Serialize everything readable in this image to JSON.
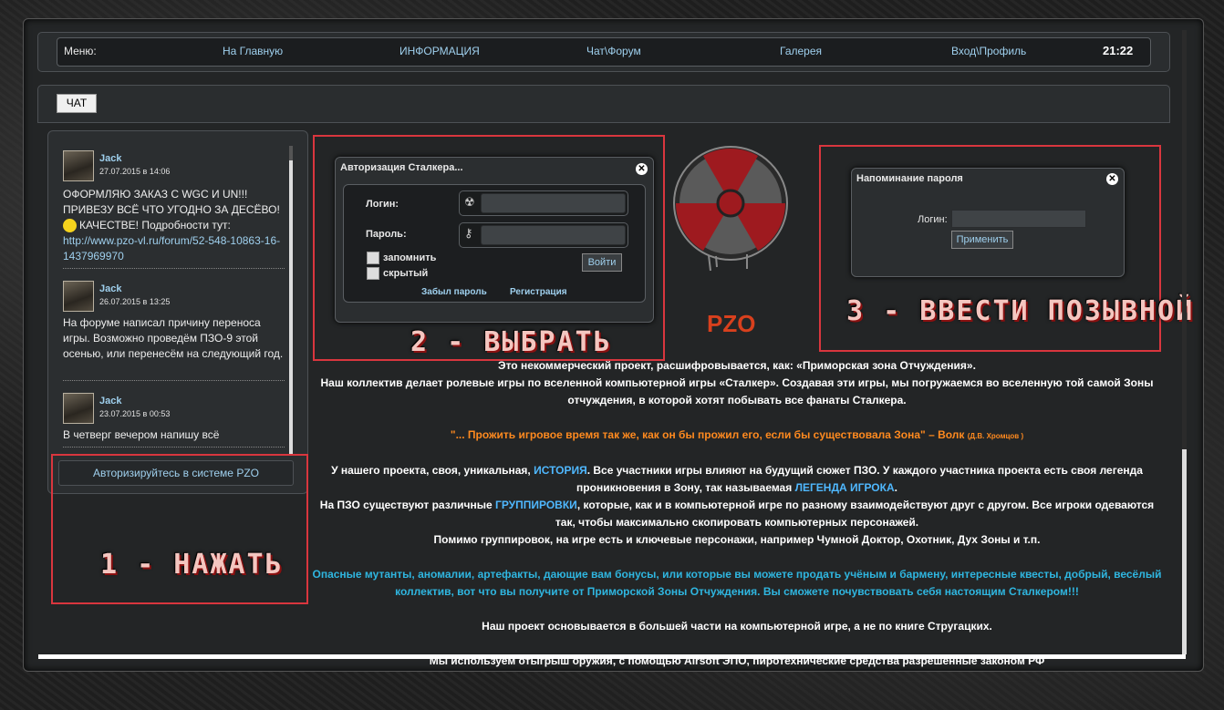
{
  "nav": {
    "menu_label": "Меню:",
    "items": [
      "На Главную",
      "ИНФОРМАЦИЯ",
      "Чат\\Форум",
      "Галерея",
      "Вход\\Профиль"
    ],
    "time": "21:22"
  },
  "chat": {
    "tab_label": "ЧАТ",
    "messages": [
      {
        "user": "Jack",
        "date": "27.07.2015 в 14:06",
        "text1": "ОФОРМЛЯЮ ЗАКАЗ С WGC И UN!!! ПРИВЕЗУ ВСЁ ЧТО УГОДНО ЗА ДЕСЁВО!",
        "text2": "КАЧЕСТВЕ! Подробности тут:",
        "link": "http://www.pzo-vl.ru/forum/52-548-10863-16-1437969970"
      },
      {
        "user": "Jack",
        "date": "26.07.2015 в 13:25",
        "text": "На форуме написал причину переноса игры. Возможно проведём ПЗО-9 этой осенью, или перенесём на следующий год."
      },
      {
        "user": "Jack",
        "date": "23.07.2015 в 00:53",
        "text": "В четверг вечером напишу всё"
      }
    ],
    "auth_button": "Авторизируйтесь в системе PZO"
  },
  "login_dialog": {
    "title": "Авторизация Сталкера...",
    "login_label": "Логин:",
    "password_label": "Пароль:",
    "remember_label": "запомнить",
    "hidden_label": "скрытый",
    "submit": "Войти",
    "forgot_link": "Забыл пароль",
    "register_link": "Регистрация"
  },
  "reminder_dialog": {
    "title": "Напоминание пароля",
    "login_label": "Логин:",
    "submit": "Применить"
  },
  "brand": "PZO",
  "annotations": {
    "step1": "1 - НАЖАТЬ",
    "step2": "2 - ВЫБРАТЬ",
    "step3": "3 - ВВЕСТИ ПОЗЫВНОЙ"
  },
  "content": {
    "p1": "Это некоммерческий проект, расшифровывается, как:  «Приморская зона Отчуждения».",
    "p2": "Наш коллектив делает ролевые игры по вселенной компьютерной игры «Сталкер».  Создавая эти игры, мы погружаемся во вселенную той самой Зоны отчуждения, в которой хотят побывать все фанаты Сталкера.",
    "quote": "\"... Прожить игровое время так же, как он бы прожил его, если бы существовала Зона\" –  Волк",
    "quote_author": "(Д.В. Хромцов )",
    "p3a": "У нашего проекта, своя, уникальная,",
    "p3_link1": "ИСТОРИЯ",
    "p3b": ". Все участники игры влияют на будущий сюжет  ПЗО. У каждого участника проекта есть своя легенда проникновения в Зону, так называемая",
    "p3_link2": "ЛЕГЕНДА ИГРОКА",
    "p3c": ".",
    "p4a": "На ПЗО существуют различные",
    "p4_link": "ГРУППИРОВКИ",
    "p4b": ", которые, как и в компьютерной игре по разному взаимодействуют друг с другом. Все игроки одеваются так, чтобы  максимально скопировать компьютерных персонажей.",
    "p5": "Помимо группировок, на игре есть и ключевые персонажи, например Чумной Доктор, Охотник, Дух Зоны и т.п.",
    "p6": "Опасные мутанты,  аномалии, артефакты, дающие вам бонусы, или которые вы можете продать учёным и бармену, интересные квесты, добрый, весёлый коллектив, вот что вы получите от Приморской Зоны Отчуждения. Вы сможете почувствовать себя настоящим Сталкером!!!",
    "p7": "Наш проект основывается в большей части на компьютерной игре, а не по книге Стругацких.",
    "p8": "Мы используем отыгрыш оружия, с помощью Airsoft ЭПО, пиротехнические средства разрешённые законом РФ"
  },
  "colors": {
    "accent": "#9fd0ee",
    "annotation_border": "#d9363e",
    "brand": "#d8401d",
    "quote": "#ff8a1f",
    "highlight": "#2fb6e0"
  }
}
